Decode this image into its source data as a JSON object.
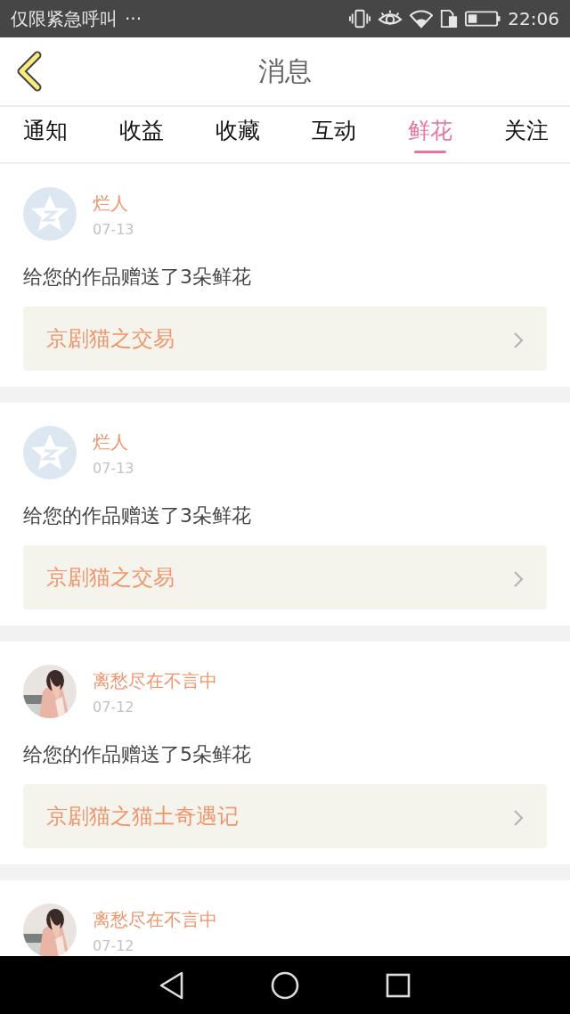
{
  "status_bar": {
    "notice": "仅限紧急呼叫",
    "more": "···",
    "time": "22:06"
  },
  "header": {
    "title": "消息"
  },
  "tabs": [
    {
      "label": "通知",
      "selected": false
    },
    {
      "label": "收益",
      "selected": false
    },
    {
      "label": "收藏",
      "selected": false
    },
    {
      "label": "互动",
      "selected": false
    },
    {
      "label": "鲜花",
      "selected": true
    },
    {
      "label": "关注",
      "selected": false
    }
  ],
  "messages": [
    {
      "avatar": {
        "kind": "default"
      },
      "name": "烂人",
      "date": "07-13",
      "text": "给您的作品赠送了3朵鲜花",
      "work": "京剧猫之交易"
    },
    {
      "avatar": {
        "kind": "default"
      },
      "name": "烂人",
      "date": "07-13",
      "text": "给您的作品赠送了3朵鲜花",
      "work": "京剧猫之交易"
    },
    {
      "name": "离愁尽在不言中",
      "date": "07-12",
      "text": "给您的作品赠送了5朵鲜花",
      "work": "京剧猫之猫土奇遇记"
    },
    {
      "name": "离愁尽在不言中",
      "date": "07-12"
    }
  ]
}
